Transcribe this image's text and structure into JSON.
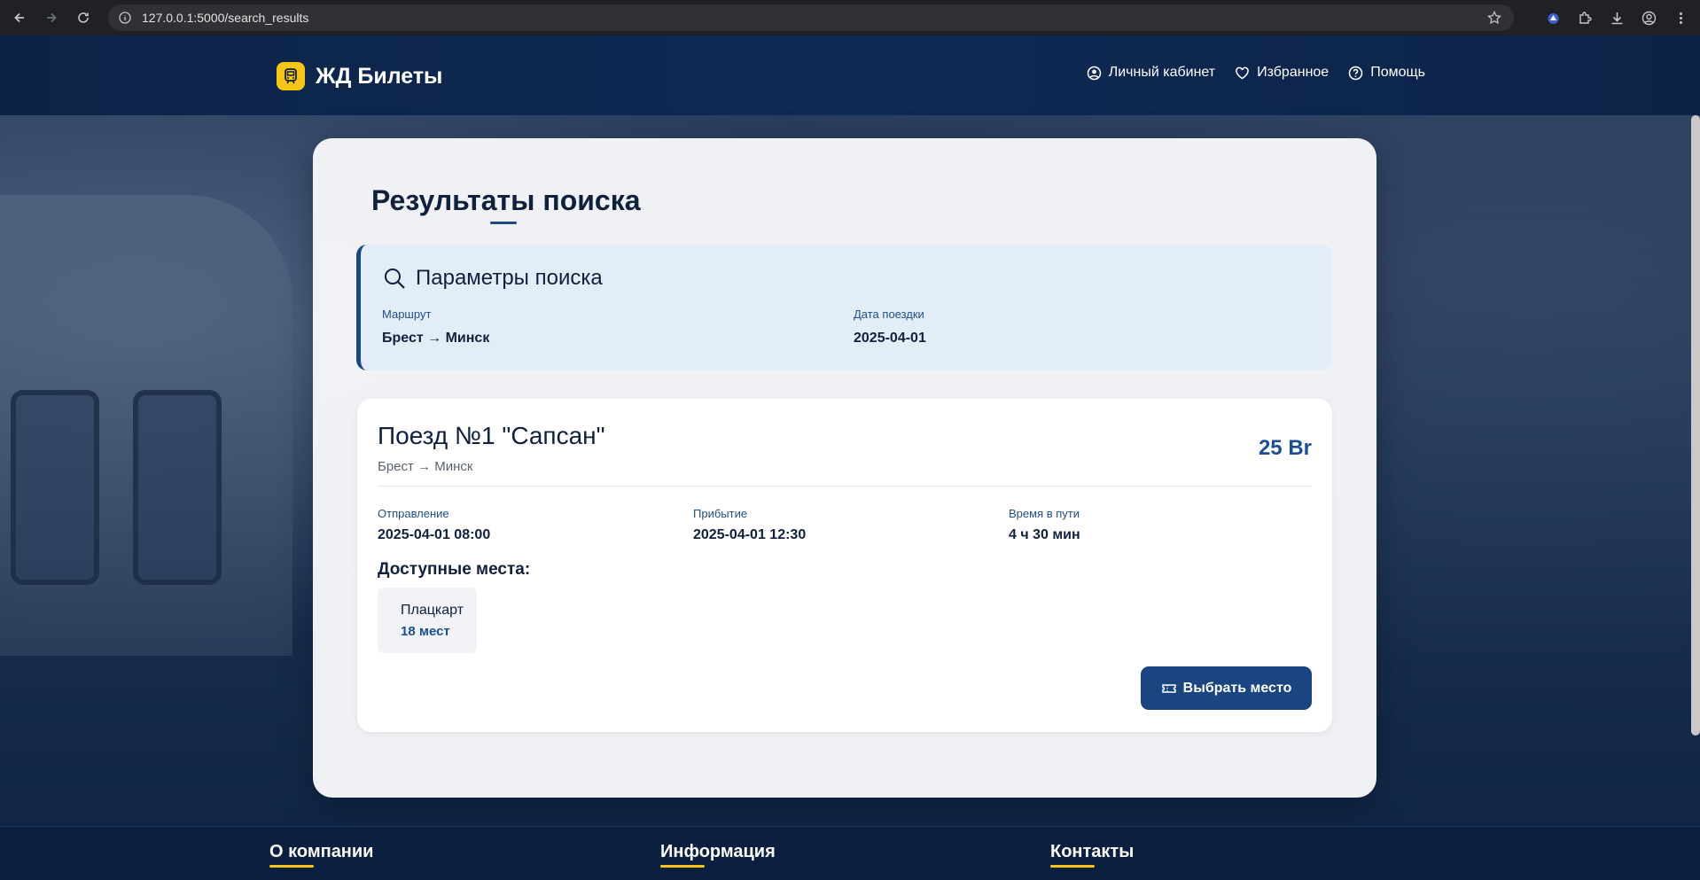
{
  "browser": {
    "url": "127.0.0.1:5000/search_results"
  },
  "header": {
    "logo_text": "ЖД Билеты",
    "nav": [
      {
        "label": "Личный кабинет",
        "icon": "user-circle-icon"
      },
      {
        "label": "Избранное",
        "icon": "heart-icon"
      },
      {
        "label": "Помощь",
        "icon": "help-circle-icon"
      }
    ]
  },
  "main": {
    "title": "Результаты поиска",
    "params": {
      "title": "Параметры поиска",
      "route_label": "Маршрут",
      "route_value": "Брест → Минск",
      "date_label": "Дата поездки",
      "date_value": "2025-04-01"
    },
    "train": {
      "name": "Поезд №1 \"Сапсан\"",
      "route": "Брест → Минск",
      "price": "25 Br",
      "departure_label": "Отправление",
      "departure_value": "2025-04-01 08:00",
      "arrival_label": "Прибытие",
      "arrival_value": "2025-04-01 12:30",
      "duration_label": "Время в пути",
      "duration_value": "4 ч 30 мин",
      "seats_title": "Доступные места:",
      "seats": [
        {
          "type": "Плацкарт",
          "count": "18 мест"
        }
      ],
      "select_button": "Выбрать место"
    }
  },
  "footer": {
    "columns": [
      "О компании",
      "Информация",
      "Контакты"
    ]
  },
  "colors": {
    "primary": "#1a4580",
    "accent": "#f5c518",
    "header_bg": "#0c2347"
  }
}
